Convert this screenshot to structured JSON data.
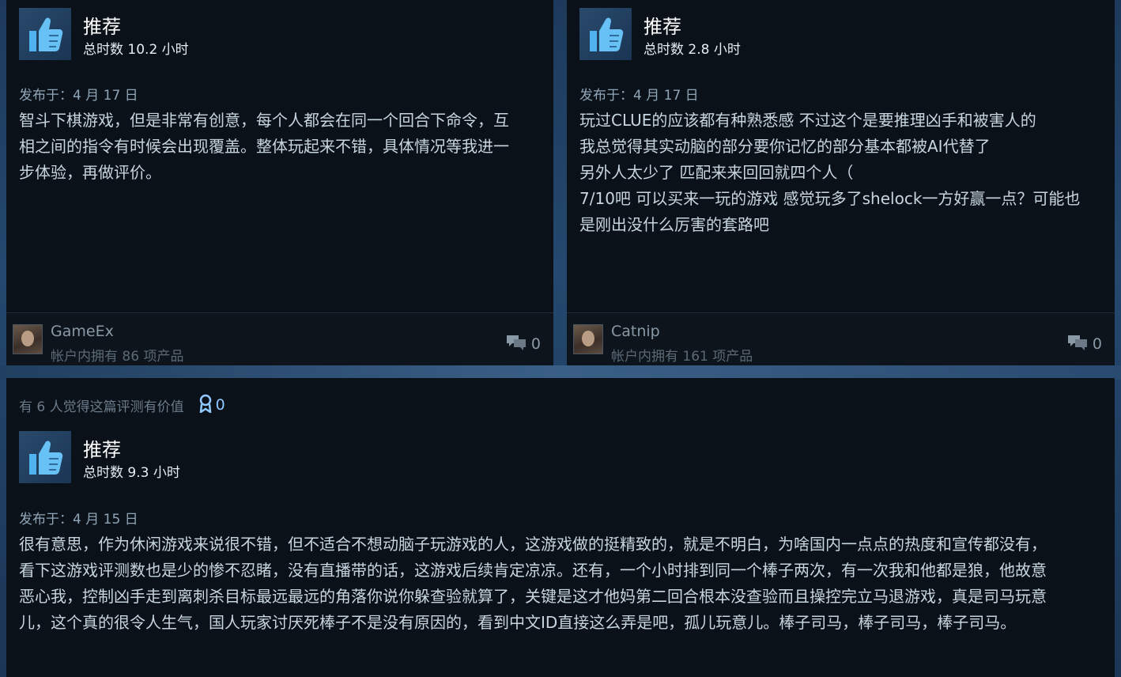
{
  "reviews": [
    {
      "recommendation": "推荐",
      "hours": "总时数 10.2 小时",
      "posted": "发布于：4 月 17 日",
      "lines": [
        "智斗下棋游戏，但是非常有创意，每个人都会在同一个回合下命令，互",
        "相之间的指令有时候会出现覆盖。整体玩起来不错，具体情况等我进一",
        "步体验，再做评价。"
      ],
      "username": "GameEx",
      "owned": "帐户内拥有 86 项产品",
      "comments": "0"
    },
    {
      "recommendation": "推荐",
      "hours": "总时数 2.8 小时",
      "posted": "发布于：4 月 17 日",
      "lines": [
        "玩过CLUE的应该都有种熟悉感 不过这个是要推理凶手和被害人的",
        "我总觉得其实动脑的部分要你记忆的部分基本都被AI代替了",
        "另外人太少了 匹配来来回回就四个人（",
        "7/10吧 可以买来一玩的游戏 感觉玩多了shelock一方好赢一点？可能也",
        "是刚出没什么厉害的套路吧"
      ],
      "username": "Catnip",
      "owned": "帐户内拥有 161 项产品",
      "comments": "0"
    },
    {
      "helpful_text": "有 6 人觉得这篇评测有价值",
      "awards": "0",
      "recommendation": "推荐",
      "hours": "总时数 9.3 小时",
      "posted": "发布于：4 月 15 日",
      "lines": [
        "很有意思，作为休闲游戏来说很不错，但不适合不想动脑子玩游戏的人，这游戏做的挺精致的，就是不明白，为啥国内一点点的热度和宣传都没有，",
        "看下这游戏评测数也是少的惨不忍睹，没有直播带的话，这游戏后续肯定凉凉。还有，一个小时排到同一个棒子两次，有一次我和他都是狼，他故意",
        "恶心我，控制凶手走到离刺杀目标最远最远的角落你说你躲查验就算了，关键是这才他妈第二回合根本没查验而且操控完立马退游戏，真是司马玩意",
        "儿，这个真的很令人生气，国人玩家讨厌死棒子不是没有原因的，看到中文ID直接这么弄是吧，孤儿玩意儿。棒子司马，棒子司马，棒子司马。"
      ]
    }
  ],
  "icons": {
    "recommend": "thumbs-up-icon",
    "comment": "comment-bubbles-icon",
    "award": "award-ribbon-icon"
  },
  "colors": {
    "card_bg": "#0b1119",
    "thumb_blue": "#67c1f5",
    "award_blue": "#8fc7ff"
  }
}
